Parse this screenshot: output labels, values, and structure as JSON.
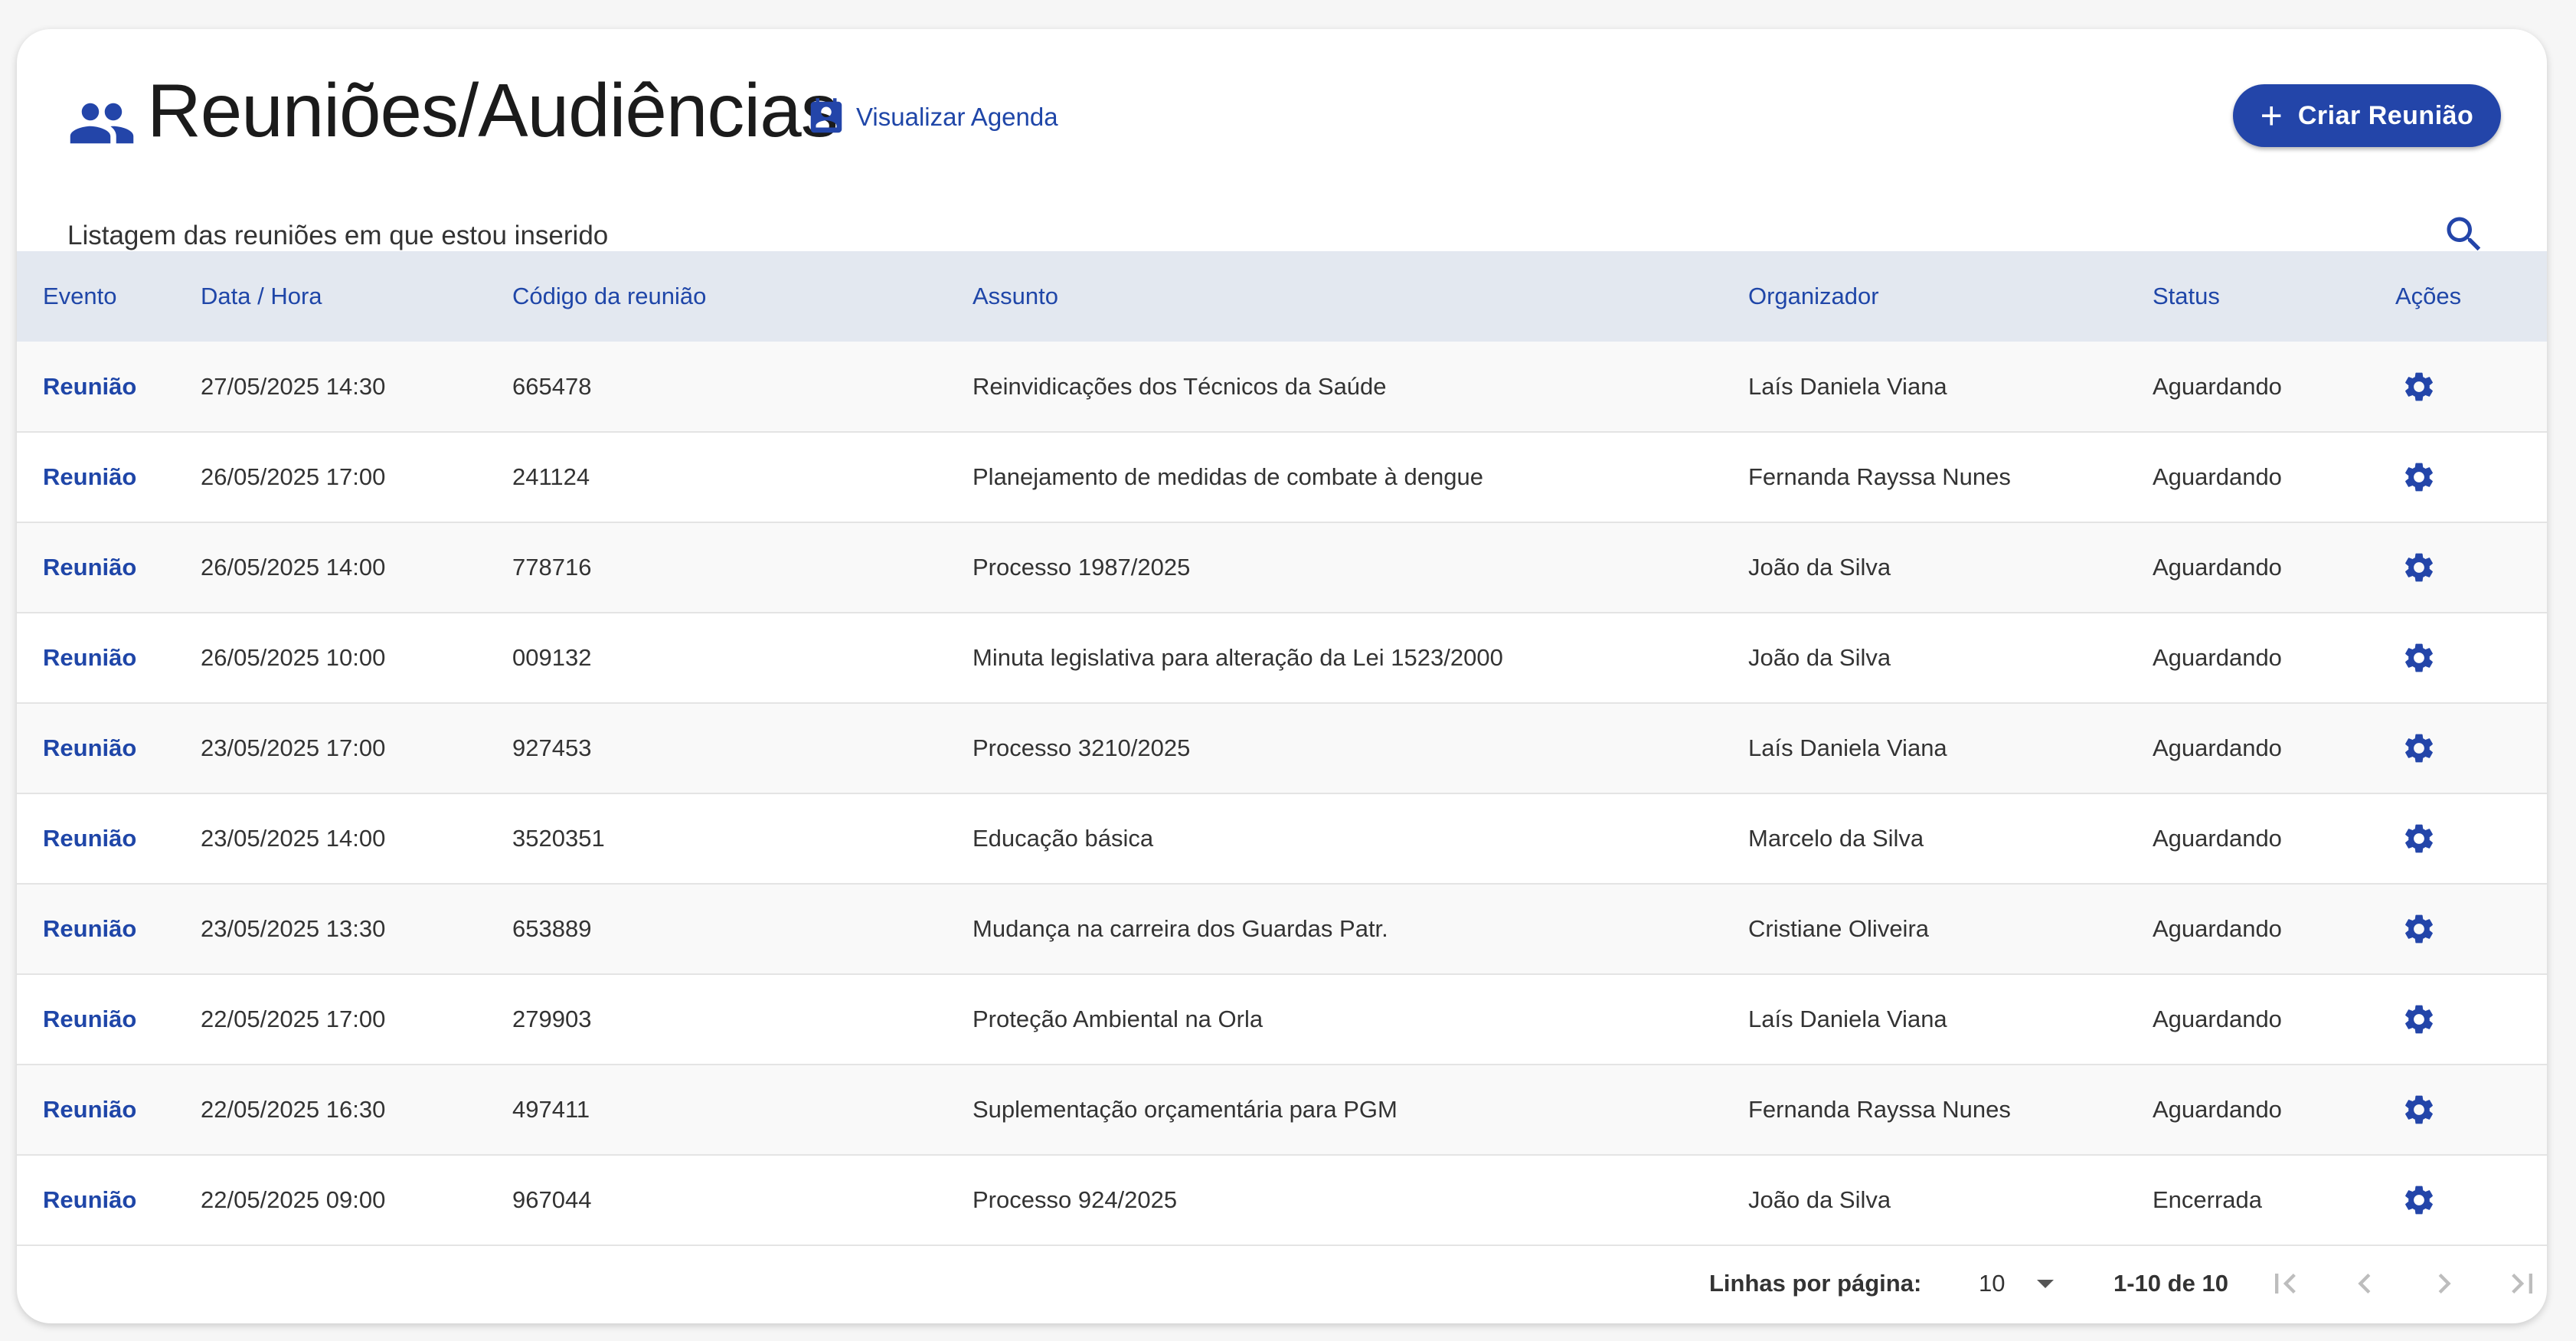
{
  "header": {
    "title": "Reuniões/Audiências",
    "agenda_link": "Visualizar Agenda",
    "create_button": "Criar Reunião",
    "subtitle": "Listagem das reuniões em que estou inserido"
  },
  "table": {
    "columns": [
      "Evento",
      "Data / Hora",
      "Código da reunião",
      "Assunto",
      "Organizador",
      "Status",
      "Ações"
    ],
    "rows": [
      {
        "evento": "Reunião",
        "data": "27/05/2025 14:30",
        "codigo": "665478",
        "assunto": "Reinvidicações dos Técnicos da Saúde",
        "organizador": "Laís Daniela Viana",
        "status": "Aguardando"
      },
      {
        "evento": "Reunião",
        "data": "26/05/2025 17:00",
        "codigo": "241124",
        "assunto": "Planejamento de medidas de combate à dengue",
        "organizador": "Fernanda Rayssa Nunes",
        "status": "Aguardando"
      },
      {
        "evento": "Reunião",
        "data": "26/05/2025 14:00",
        "codigo": "778716",
        "assunto": "Processo 1987/2025",
        "organizador": "João da Silva",
        "status": "Aguardando"
      },
      {
        "evento": "Reunião",
        "data": "26/05/2025 10:00",
        "codigo": "009132",
        "assunto": "Minuta legislativa para alteração da Lei 1523/2000",
        "organizador": "João da Silva",
        "status": "Aguardando"
      },
      {
        "evento": "Reunião",
        "data": "23/05/2025 17:00",
        "codigo": "927453",
        "assunto": "Processo 3210/2025",
        "organizador": "Laís Daniela Viana",
        "status": "Aguardando"
      },
      {
        "evento": "Reunião",
        "data": "23/05/2025 14:00",
        "codigo": "3520351",
        "assunto": "Educação básica",
        "organizador": "Marcelo da Silva",
        "status": "Aguardando"
      },
      {
        "evento": "Reunião",
        "data": "23/05/2025 13:30",
        "codigo": "653889",
        "assunto": "Mudança na carreira dos Guardas Patr.",
        "organizador": "Cristiane Oliveira",
        "status": "Aguardando"
      },
      {
        "evento": "Reunião",
        "data": "22/05/2025 17:00",
        "codigo": "279903",
        "assunto": "Proteção Ambiental na Orla",
        "organizador": "Laís Daniela Viana",
        "status": "Aguardando"
      },
      {
        "evento": "Reunião",
        "data": "22/05/2025 16:30",
        "codigo": "497411",
        "assunto": "Suplementação orçamentária para PGM",
        "organizador": "Fernanda Rayssa Nunes",
        "status": "Aguardando"
      },
      {
        "evento": "Reunião",
        "data": "22/05/2025 09:00",
        "codigo": "967044",
        "assunto": "Processo 924/2025",
        "organizador": "João da Silva",
        "status": "Encerrada"
      }
    ]
  },
  "footer": {
    "rows_per_page_label": "Linhas por página:",
    "rows_per_page_value": "10",
    "range": "1-10 de 10"
  },
  "icons": {
    "title": "people-icon",
    "agenda": "contact-calendar-icon",
    "create": "plus-icon",
    "search": "search-icon",
    "action": "gear-icon",
    "pagination": [
      "first-page-icon",
      "prev-page-icon",
      "next-page-icon",
      "last-page-icon"
    ]
  },
  "colors": {
    "accent": "#2345a9",
    "link": "#1f46a8",
    "header_bg": "#e3e8f0",
    "pager_disabled": "#bdbdbd"
  }
}
